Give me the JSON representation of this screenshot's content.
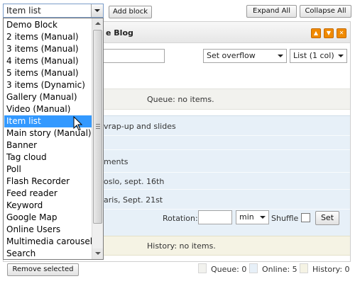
{
  "toolbar": {
    "add_block": "Add block",
    "expand_all": "Expand All",
    "collapse_all": "Collapse All"
  },
  "block_type": {
    "selected": "Item list",
    "options": [
      "Demo Block",
      "2 items (Manual)",
      "3 items (Manual)",
      "4 items (Manual)",
      "5 items (Manual)",
      "3 items (Dynamic)",
      "Gallery (Manual)",
      "Video (Manual)",
      "Item list",
      "Main story (Manual)",
      "Banner",
      "Tag cloud",
      "Poll",
      "Flash Recorder",
      "Feed reader",
      "Keyword",
      "Google Map",
      "Online Users",
      "Multimedia carousel",
      "Search"
    ]
  },
  "panel": {
    "title": "e Blog",
    "overflow_select": "Set overflow",
    "layout_select": "List (1 col)",
    "queue_empty": "Queue: no items.",
    "rows": [
      "vrap-up and slides",
      "ments",
      "oslo, sept. 16th",
      "aris, Sept. 21st"
    ],
    "rotation_label": "Rotation:",
    "rotation_unit": "min",
    "shuffle_label": "Shuffle",
    "set_button": "Set",
    "history_empty": "History: no items."
  },
  "footer": {
    "remove_selected": "Remove selected",
    "queue_count": "Queue: 0",
    "online_count": "Online: 5",
    "history_count": "History: 0"
  },
  "colors": {
    "queue": "#f2f2ee",
    "online": "#e7f0f8",
    "history": "#f5f3e4",
    "selection": "#3399ff",
    "accent": "#f08a00"
  }
}
